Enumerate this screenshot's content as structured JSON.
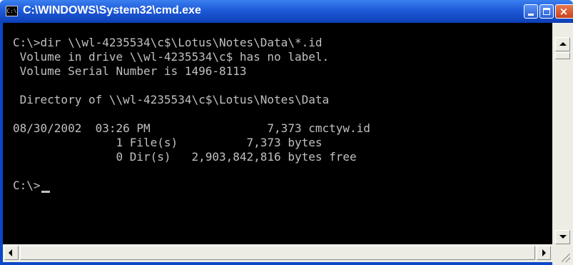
{
  "window": {
    "title": "C:\\WINDOWS\\System32\\cmd.exe",
    "icon_text": "C:\\",
    "controls": [
      "minimize-icon",
      "maximize-icon",
      "close-icon"
    ],
    "close_glyph": "×"
  },
  "console": {
    "lines": [
      "C:\\>dir \\\\wl-4235534\\c$\\Lotus\\Notes\\Data\\*.id",
      " Volume in drive \\\\wl-4235534\\c$ has no label.",
      " Volume Serial Number is 1496-8113",
      "",
      " Directory of \\\\wl-4235534\\c$\\Lotus\\Notes\\Data",
      "",
      "08/30/2002  03:26 PM                 7,373 cmctyw.id",
      "               1 File(s)          7,373 bytes",
      "               0 Dir(s)   2,903,842,816 bytes free",
      "",
      "C:\\>"
    ]
  },
  "colors": {
    "console_background": "#000000",
    "console_text": "#c0c0c0",
    "titlebar": "#1e5ad8",
    "close_button": "#d8502c"
  }
}
